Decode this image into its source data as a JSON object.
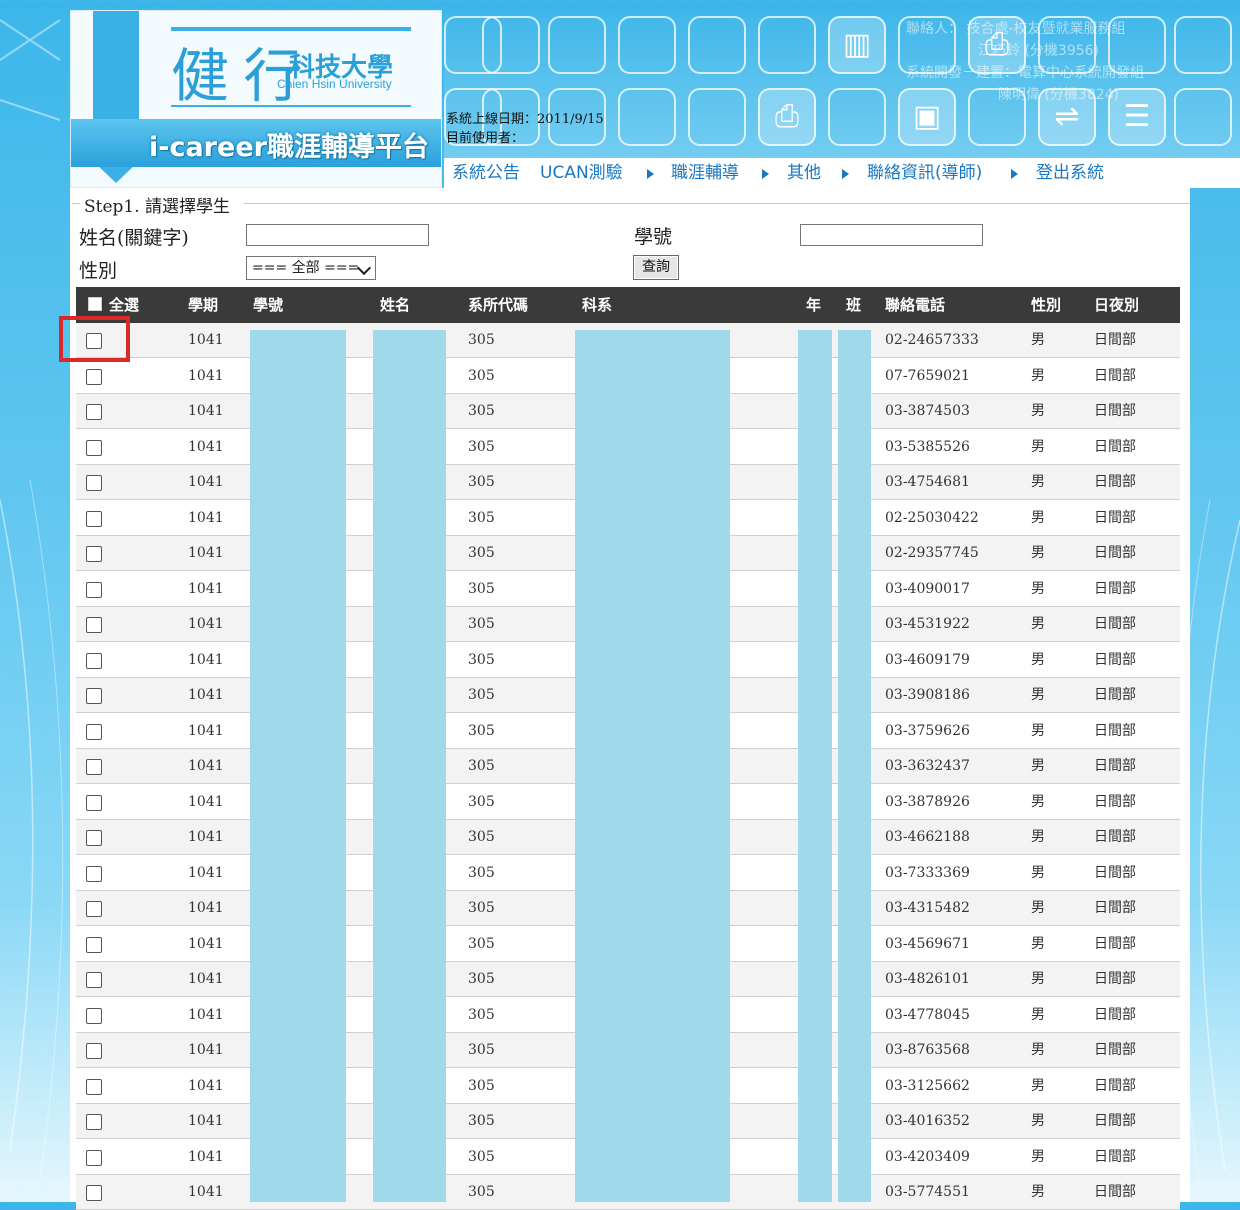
{
  "logo": {
    "char": "健 行",
    "name": "科技大學",
    "english": "Chien Hsin University",
    "platform": "i-career職涯輔導平台"
  },
  "system": {
    "online_date": "系統上線日期：2011/9/15",
    "current_user": "目前使用者："
  },
  "contact": {
    "line1": "聯絡人：  技合處-校友暨就業服務組",
    "line2": "江巧鈴 (分機3956)",
    "line3": "系統開發－建置：電算中心系統開發組",
    "line4": "陳明偉 (分機3824)"
  },
  "nav": {
    "announce": "系統公告",
    "ucan": "UCAN測驗",
    "career": "職涯輔導",
    "other": "其他",
    "contact": "聯絡資訊(導師)",
    "logout": "登出系統"
  },
  "form": {
    "step_title": "Step1. 請選擇學生",
    "name_label": "姓名(關鍵字)",
    "id_label": "學號",
    "gender_label": "性別",
    "gender_select": "=== 全部 ===",
    "query_button": "查詢",
    "name_value": "",
    "id_value": ""
  },
  "table": {
    "headers": {
      "select_all": "全選",
      "term": "學期",
      "student_id": "學號",
      "name": "姓名",
      "dept_code": "系所代碼",
      "department": "科系",
      "year": "年",
      "class": "班",
      "phone": "聯絡電話",
      "gender": "性別",
      "division": "日夜別"
    },
    "rows": [
      {
        "term": "1041",
        "dept_code": "305",
        "phone": "02-24657333",
        "gender": "男",
        "division": "日間部"
      },
      {
        "term": "1041",
        "dept_code": "305",
        "phone": "07-7659021",
        "gender": "男",
        "division": "日間部"
      },
      {
        "term": "1041",
        "dept_code": "305",
        "phone": "03-3874503",
        "gender": "男",
        "division": "日間部"
      },
      {
        "term": "1041",
        "dept_code": "305",
        "phone": "03-5385526",
        "gender": "男",
        "division": "日間部"
      },
      {
        "term": "1041",
        "dept_code": "305",
        "phone": "03-4754681",
        "gender": "男",
        "division": "日間部"
      },
      {
        "term": "1041",
        "dept_code": "305",
        "phone": "02-25030422",
        "gender": "男",
        "division": "日間部"
      },
      {
        "term": "1041",
        "dept_code": "305",
        "phone": "02-29357745",
        "gender": "男",
        "division": "日間部"
      },
      {
        "term": "1041",
        "dept_code": "305",
        "phone": "03-4090017",
        "gender": "男",
        "division": "日間部"
      },
      {
        "term": "1041",
        "dept_code": "305",
        "phone": "03-4531922",
        "gender": "男",
        "division": "日間部"
      },
      {
        "term": "1041",
        "dept_code": "305",
        "phone": "03-4609179",
        "gender": "男",
        "division": "日間部"
      },
      {
        "term": "1041",
        "dept_code": "305",
        "phone": "03-3908186",
        "gender": "男",
        "division": "日間部"
      },
      {
        "term": "1041",
        "dept_code": "305",
        "phone": "03-3759626",
        "gender": "男",
        "division": "日間部"
      },
      {
        "term": "1041",
        "dept_code": "305",
        "phone": "03-3632437",
        "gender": "男",
        "division": "日間部"
      },
      {
        "term": "1041",
        "dept_code": "305",
        "phone": "03-3878926",
        "gender": "男",
        "division": "日間部"
      },
      {
        "term": "1041",
        "dept_code": "305",
        "phone": "03-4662188",
        "gender": "男",
        "division": "日間部"
      },
      {
        "term": "1041",
        "dept_code": "305",
        "phone": "03-7333369",
        "gender": "男",
        "division": "日間部"
      },
      {
        "term": "1041",
        "dept_code": "305",
        "phone": "03-4315482",
        "gender": "男",
        "division": "日間部"
      },
      {
        "term": "1041",
        "dept_code": "305",
        "phone": "03-4569671",
        "gender": "男",
        "division": "日間部"
      },
      {
        "term": "1041",
        "dept_code": "305",
        "phone": "03-4826101",
        "gender": "男",
        "division": "日間部"
      },
      {
        "term": "1041",
        "dept_code": "305",
        "phone": "03-4778045",
        "gender": "男",
        "division": "日間部"
      },
      {
        "term": "1041",
        "dept_code": "305",
        "phone": "03-8763568",
        "gender": "男",
        "division": "日間部"
      },
      {
        "term": "1041",
        "dept_code": "305",
        "phone": "03-3125662",
        "gender": "男",
        "division": "日間部"
      },
      {
        "term": "1041",
        "dept_code": "305",
        "phone": "03-4016352",
        "gender": "男",
        "division": "日間部"
      },
      {
        "term": "1041",
        "dept_code": "305",
        "phone": "03-4203409",
        "gender": "男",
        "division": "日間部"
      },
      {
        "term": "1041",
        "dept_code": "305",
        "phone": "03-5774551",
        "gender": "男",
        "division": "日間部"
      }
    ]
  },
  "icons": {
    "tile_icons": [
      "cabinet-icon",
      "printer-icon",
      "computer-icon",
      "usb-icon",
      "server-icon"
    ]
  },
  "colors": {
    "brand_blue": "#2a9fd8",
    "nav_link": "#1a78c2",
    "table_header": "#3a3a3a",
    "redaction": "#9fd9ea",
    "highlight_red": "#d92a2a"
  }
}
